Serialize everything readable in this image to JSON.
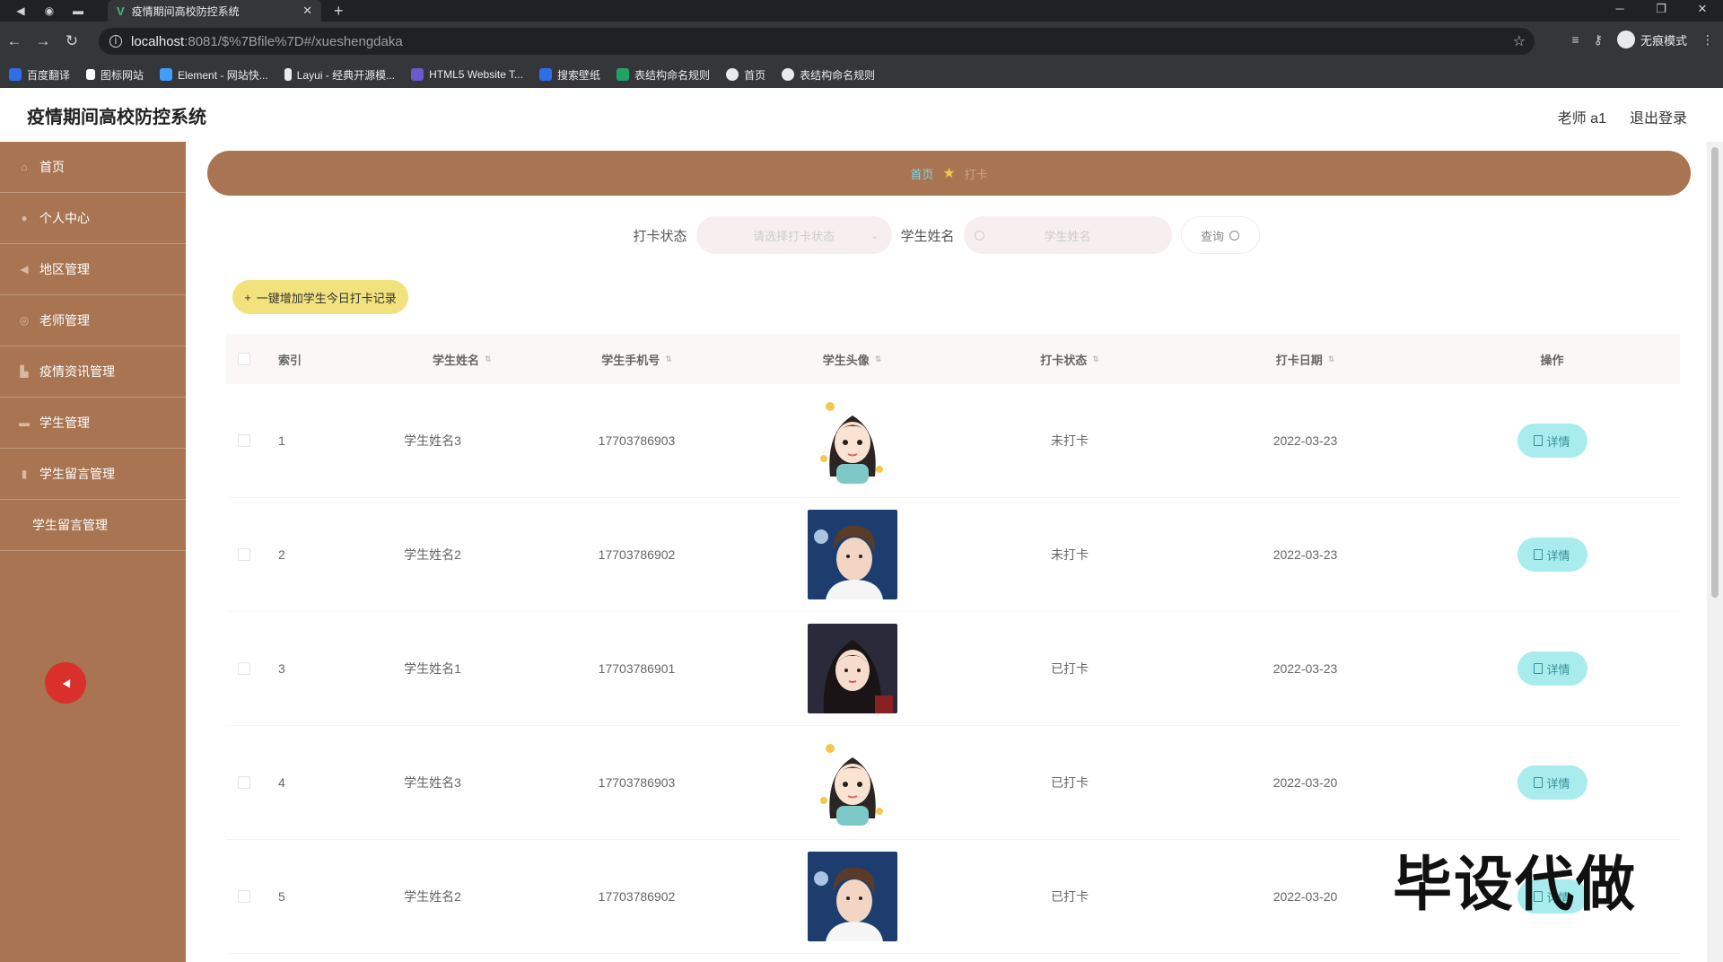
{
  "browser": {
    "tab_title": "疫情期间高校防控系统",
    "url_host": "localhost",
    "url_path": ":8081/$%7Bfile%7D#/xueshengdaka",
    "incognito_label": "无痕模式",
    "bookmarks": [
      {
        "label": "百度翻译",
        "color": "#2f6ee8"
      },
      {
        "label": "图标网站",
        "color": "#ffffff"
      },
      {
        "label": "Element - 网站快...",
        "color": "#409eff"
      },
      {
        "label": "Layui - 经典开源模...",
        "color": "#e8eaed"
      },
      {
        "label": "HTML5 Website T...",
        "color": "#6a5acd"
      },
      {
        "label": "搜索壁纸",
        "color": "#2f6ee8"
      },
      {
        "label": "表结构命名规则",
        "color": "#21a366"
      },
      {
        "label": "首页",
        "color": "#e8eaed"
      },
      {
        "label": "表结构命名规则",
        "color": "#e8eaed"
      }
    ]
  },
  "header": {
    "title": "疫情期间高校防控系统",
    "user": "老师 a1",
    "logout": "退出登录"
  },
  "sidebar": {
    "items": [
      {
        "label": "首页",
        "icon": "home-icon"
      },
      {
        "label": "个人中心",
        "icon": "user-icon"
      },
      {
        "label": "地区管理",
        "icon": "location-icon"
      },
      {
        "label": "老师管理",
        "icon": "teacher-icon"
      },
      {
        "label": "疫情资讯管理",
        "icon": "news-icon"
      },
      {
        "label": "学生管理",
        "icon": "student-icon"
      },
      {
        "label": "学生留言管理",
        "icon": "message-icon"
      }
    ],
    "sub_item": "学生留言管理"
  },
  "breadcrumb": {
    "home": "首页",
    "current": "打卡"
  },
  "search": {
    "status_label": "打卡状态",
    "status_placeholder": "请选择打卡状态",
    "name_label": "学生姓名",
    "name_placeholder": "学生姓名",
    "query_button": "查询"
  },
  "add_button": "一键增加学生今日打卡记录",
  "table": {
    "headers": {
      "index": "索引",
      "name": "学生姓名",
      "phone": "学生手机号",
      "avatar": "学生头像",
      "status": "打卡状态",
      "date": "打卡日期",
      "op": "操作"
    },
    "detail_label": "详情",
    "rows": [
      {
        "index": "1",
        "name": "学生姓名3",
        "phone": "17703786903",
        "avatar": "cartoon-girl",
        "status": "未打卡",
        "date": "2022-03-23"
      },
      {
        "index": "2",
        "name": "学生姓名2",
        "phone": "17703786902",
        "avatar": "boy-photo",
        "status": "未打卡",
        "date": "2022-03-23"
      },
      {
        "index": "3",
        "name": "学生姓名1",
        "phone": "17703786901",
        "avatar": "girl-photo",
        "status": "已打卡",
        "date": "2022-03-23"
      },
      {
        "index": "4",
        "name": "学生姓名3",
        "phone": "17703786903",
        "avatar": "cartoon-girl",
        "status": "已打卡",
        "date": "2022-03-20"
      },
      {
        "index": "5",
        "name": "学生姓名2",
        "phone": "17703786902",
        "avatar": "boy-photo",
        "status": "已打卡",
        "date": "2022-03-20"
      }
    ]
  },
  "watermark": "毕设代做",
  "colors": {
    "sidebar": "#a87451",
    "add_button": "#f2e27d",
    "detail_button": "#a8ecee"
  }
}
